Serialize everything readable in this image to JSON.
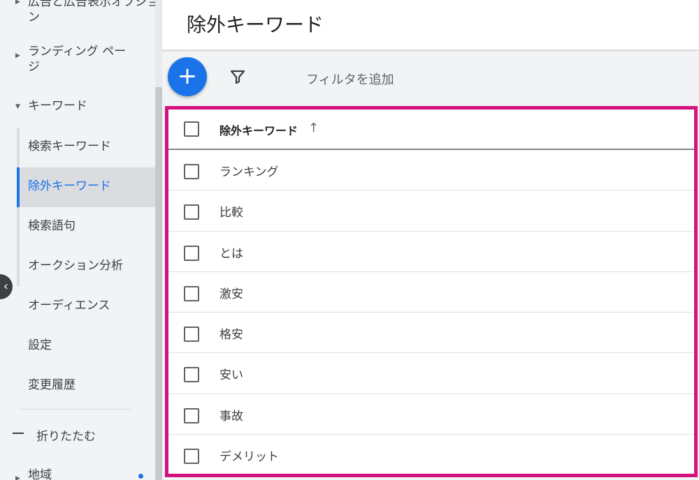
{
  "sidebar": {
    "groups": {
      "ads_assets": "広告と広告表示オプション",
      "landing_pages_line1": "ランディング ペー",
      "landing_pages_line2": "ジ",
      "keywords": "キーワード",
      "audiences": "オーディエンス",
      "settings": "設定",
      "change_history": "変更履歴",
      "region": "地域"
    },
    "keyword_children": [
      "検索キーワード",
      "除外キーワード",
      "検索語句",
      "オークション分析"
    ],
    "collapse_label": "折りたたむ"
  },
  "page": {
    "title": "除外キーワード"
  },
  "toolbar": {
    "add_icon": "plus-icon",
    "filter_icon": "filter-icon",
    "filter_label": "フィルタを追加"
  },
  "table": {
    "header": "除外キーワード",
    "sort_icon": "arrow-up-icon",
    "rows": [
      "ランキング",
      "比較",
      "とは",
      "激安",
      "格安",
      "安い",
      "事故",
      "デメリット"
    ]
  },
  "colors": {
    "accent": "#1a73e8",
    "highlight_border": "#d4117f"
  }
}
